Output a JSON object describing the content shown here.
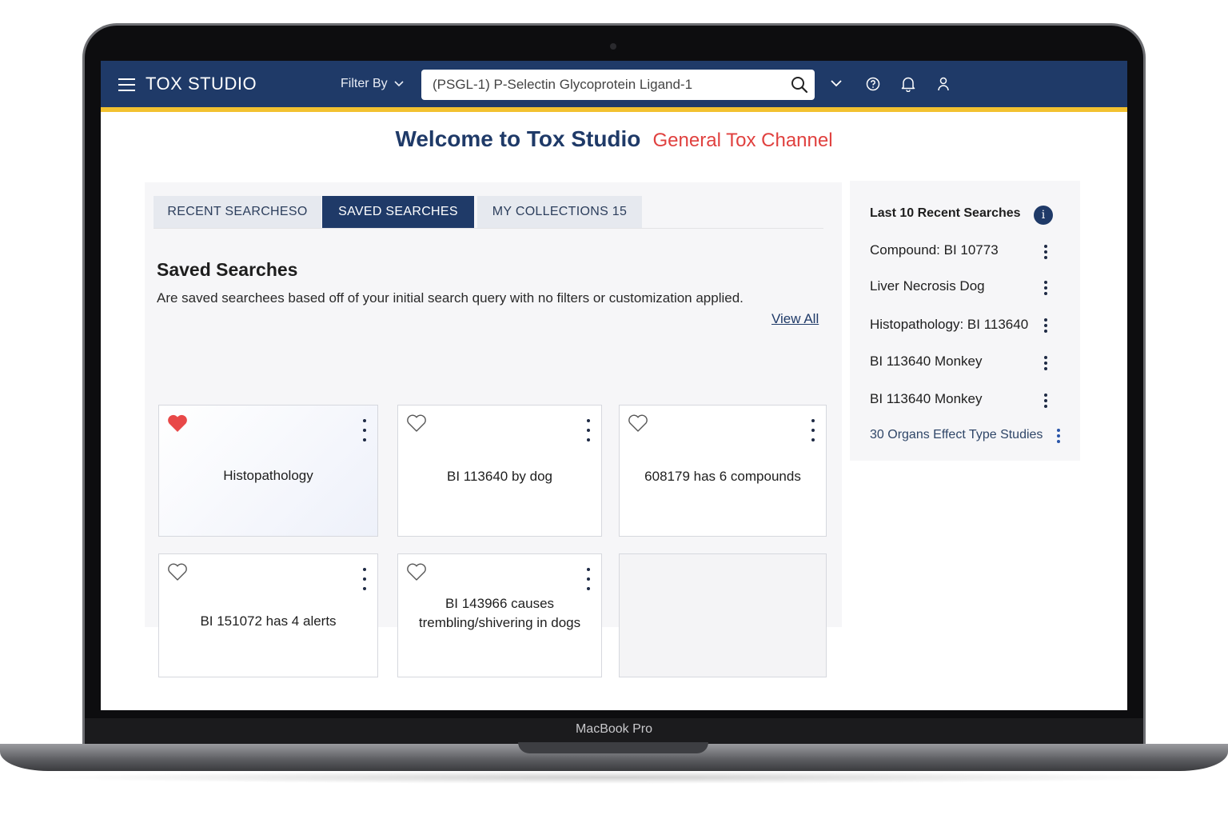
{
  "device": {
    "label": "MacBook Pro"
  },
  "header": {
    "app_title": "TOX STUDIO",
    "filter_label": "Filter By",
    "search_value": "(PSGL-1) P-Selectin Glycoprotein Ligand-1",
    "icons": [
      "menu-icon",
      "chevron-down-icon",
      "search-icon",
      "help-icon",
      "bell-icon",
      "user-icon"
    ],
    "accent_color": "#f2c130",
    "bar_color": "#1f3a68"
  },
  "welcome": {
    "title": "Welcome to Tox Studio",
    "channel": "General Tox Channel",
    "channel_color": "#e0413f"
  },
  "tabs": [
    {
      "label": "RECENT SEARCHESO",
      "active": false
    },
    {
      "label": "SAVED SEARCHES",
      "active": true
    },
    {
      "label": "MY COLLECTIONS 15",
      "active": false
    }
  ],
  "saved": {
    "title": "Saved Searches",
    "description": "Are saved searchees based off of your initial search query with no filters or customization applied.",
    "view_all": "View All",
    "cards": [
      {
        "label": "Histopathology",
        "favorite": true
      },
      {
        "label": "BI 113640 by dog",
        "favorite": false
      },
      {
        "label": "608179 has 6 compounds",
        "favorite": false
      },
      {
        "label": "BI 151072 has 4 alerts",
        "favorite": false
      },
      {
        "label": "BI 143966 causes trembling/shivering in dogs",
        "favorite": false
      },
      {
        "label": "",
        "empty": true
      }
    ]
  },
  "recent": {
    "title": "Last 10 Recent Searches",
    "items": [
      "Compound: BI 10773",
      "Liver Necrosis Dog",
      "Histopathology: BI 113640",
      "BI 113640 Monkey",
      "BI 113640 Monkey",
      "30 Organs Effect Type Studies"
    ]
  }
}
